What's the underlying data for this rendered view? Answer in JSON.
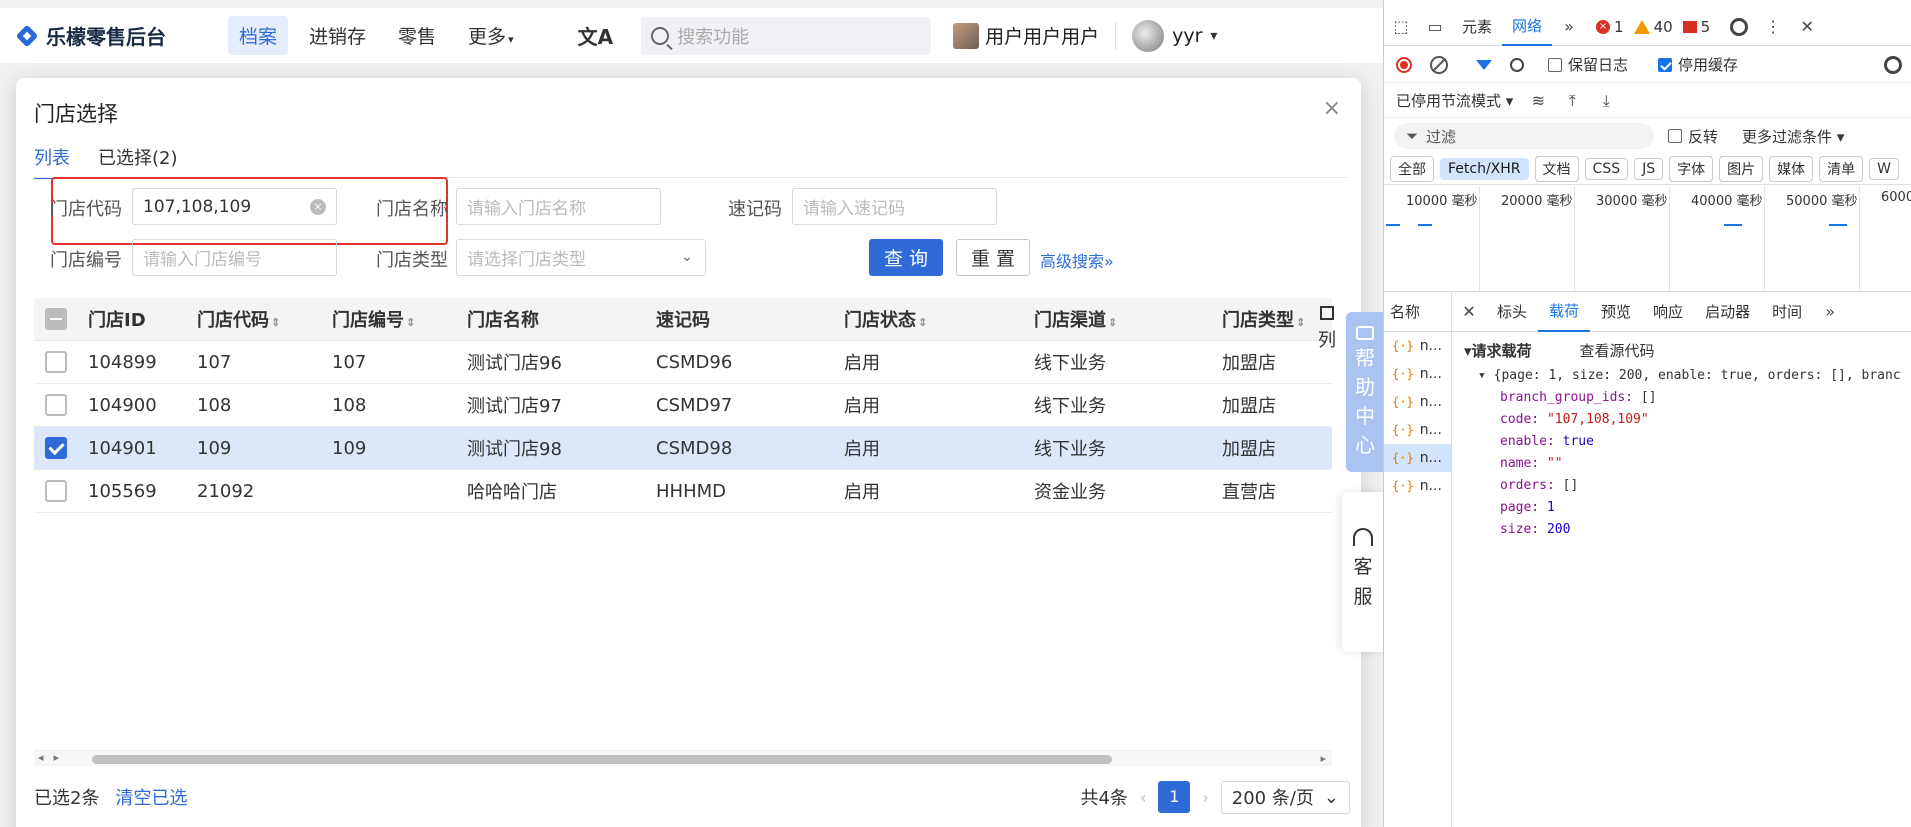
{
  "app": {
    "logo_text": "乐檬零售后台",
    "nav": [
      "档案",
      "进销存",
      "零售",
      "更多"
    ],
    "search_placeholder": "搜索功能",
    "translate_icon": "文A",
    "company": "用户用户用户",
    "user": "yyr"
  },
  "modal": {
    "title": "门店选择",
    "close": "×",
    "tabs": [
      "列表",
      "已选择(2)"
    ],
    "form": {
      "code_label": "门店代码",
      "code_value": "107,108,109",
      "name_label": "门店名称",
      "name_placeholder": "请输入门店名称",
      "shortcode_label": "速记码",
      "shortcode_placeholder": "请输入速记码",
      "number_label": "门店编号",
      "number_placeholder": "请输入门店编号",
      "type_label": "门店类型",
      "type_placeholder": "请选择门店类型",
      "query_button": "查 询",
      "reset_button": "重 置",
      "advanced": "高级搜索"
    },
    "table": {
      "headers": [
        "门店ID",
        "门店代码",
        "门店编号",
        "门店名称",
        "速记码",
        "门店状态",
        "门店渠道",
        "门店类型"
      ],
      "rows": [
        {
          "checked": false,
          "id": "104899",
          "code": "107",
          "no": "107",
          "name": "测试门店96",
          "shortcode": "CSMD96",
          "status": "启用",
          "channel": "线下业务",
          "type": "加盟店"
        },
        {
          "checked": false,
          "id": "104900",
          "code": "108",
          "no": "108",
          "name": "测试门店97",
          "shortcode": "CSMD97",
          "status": "启用",
          "channel": "线下业务",
          "type": "加盟店"
        },
        {
          "checked": true,
          "id": "104901",
          "code": "109",
          "no": "109",
          "name": "测试门店98",
          "shortcode": "CSMD98",
          "status": "启用",
          "channel": "线下业务",
          "type": "加盟店"
        },
        {
          "checked": false,
          "id": "105569",
          "code": "21092",
          "no": "",
          "name": "哈哈哈门店",
          "shortcode": "HHHMD",
          "status": "启用",
          "channel": "资金业务",
          "type": "直营店"
        }
      ],
      "col_settings": "列"
    },
    "footer": {
      "selected_text": "已选2条",
      "clear_text": "清空已选",
      "total_text": "共4条",
      "current_page": "1",
      "page_size": "200 条/页"
    }
  },
  "float": {
    "help": [
      "帮",
      "助",
      "中",
      "心"
    ],
    "cs": [
      "客",
      "服"
    ]
  },
  "devtools": {
    "tabs": [
      "元素",
      "网络"
    ],
    "errors": "1",
    "warnings": "40",
    "issues": "5",
    "preserve_log": "保留日志",
    "disable_cache": "停用缓存",
    "throttle": "已停用节流模式",
    "filter_placeholder": "过滤",
    "invert": "反转",
    "more_filters": "更多过滤条件",
    "types": [
      "全部",
      "Fetch/XHR",
      "文档",
      "CSS",
      "JS",
      "字体",
      "图片",
      "媒体",
      "清单",
      "W"
    ],
    "timeline": [
      "10000 毫秒",
      "20000 毫秒",
      "30000 毫秒",
      "40000 毫秒",
      "50000 毫秒",
      "6000"
    ],
    "name_col": "名称",
    "subtabs": [
      "标头",
      "载荷",
      "预览",
      "响应",
      "启动器",
      "时间"
    ],
    "requests": [
      "n...",
      "n...",
      "n...",
      "n...",
      "n...",
      "n..."
    ],
    "payload_title": "请求载荷",
    "view_source": "查看源代码",
    "payload_summary": "{page: 1, size: 200, enable: true, orders: [], branc",
    "payload": {
      "branch_group_ids": "[]",
      "code": "\"107,108,109\"",
      "enable": "true",
      "name": "\"\"",
      "orders": "[]",
      "page": "1",
      "size": "200"
    }
  }
}
